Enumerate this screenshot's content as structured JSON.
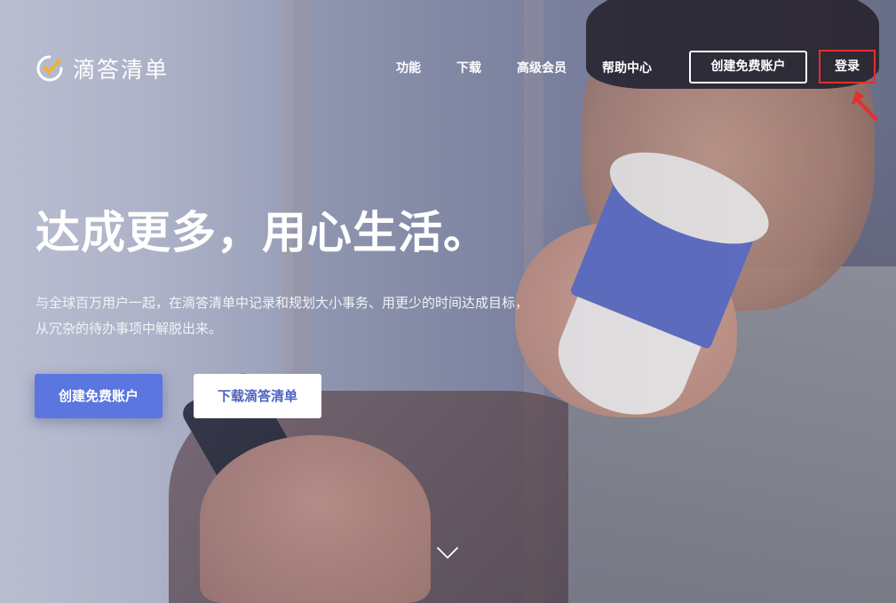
{
  "brand": {
    "name": "滴答清单",
    "icon": "checkmark-clock-icon",
    "accent": "#f5b21f"
  },
  "nav": {
    "items": [
      {
        "label": "功能"
      },
      {
        "label": "下载"
      },
      {
        "label": "高级会员"
      },
      {
        "label": "帮助中心"
      }
    ],
    "create_account": "创建免费账户",
    "login": "登录"
  },
  "hero": {
    "title": "达成更多，用心生活。",
    "description_line1": "与全球百万用户一起，在滴答清单中记录和规划大小事务、用更少的时间达成目标，",
    "description_line2": "从冗杂的待办事项中解脱出来。",
    "primary_button": "创建免费账户",
    "secondary_button": "下载滴答清单",
    "scroll_icon": "chevron-down-icon"
  },
  "annotation": {
    "color": "#e4312b",
    "icon": "red-arrow-icon"
  },
  "colors": {
    "primary": "#5b76e0",
    "secondary_text": "#4d62c2"
  }
}
